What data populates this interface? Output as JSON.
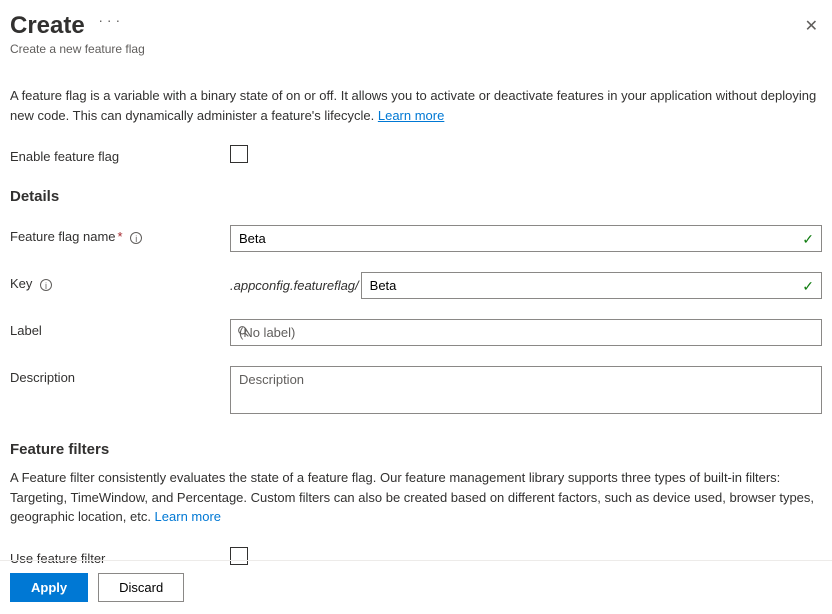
{
  "header": {
    "title": "Create",
    "subtitle": "Create a new feature flag"
  },
  "intro": {
    "text": "A feature flag is a variable with a binary state of on or off. It allows you to activate or deactivate features in your application without deploying new code. This can dynamically administer a feature's lifecycle. ",
    "learn_more": "Learn more"
  },
  "enable": {
    "label": "Enable feature flag"
  },
  "details": {
    "heading": "Details",
    "name_label": "Feature flag name",
    "name_value": "Beta",
    "key_label": "Key",
    "key_prefix": ".appconfig.featureflag/",
    "key_value": "Beta",
    "label_label": "Label",
    "label_placeholder": "(No label)",
    "desc_label": "Description",
    "desc_placeholder": "Description"
  },
  "filters": {
    "heading": "Feature filters",
    "text": "A Feature filter consistently evaluates the state of a feature flag. Our feature management library supports three types of built-in filters: Targeting, TimeWindow, and Percentage. Custom filters can also be created based on different factors, such as device used, browser types, geographic location, etc. ",
    "learn_more": "Learn more",
    "use_label": "Use feature filter"
  },
  "footer": {
    "apply": "Apply",
    "discard": "Discard"
  }
}
